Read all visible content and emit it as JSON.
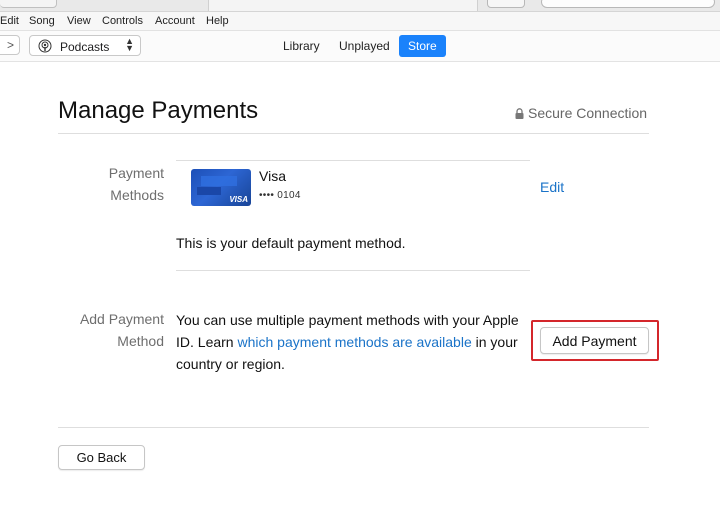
{
  "menu": [
    "Edit",
    "Song",
    "View",
    "Controls",
    "Account",
    "Help"
  ],
  "toolbar": {
    "forward_glyph": ">",
    "media_kind": "Podcasts",
    "media_icon": "podcast-icon",
    "tabs": [
      {
        "label": "Library",
        "active": false
      },
      {
        "label": "Unplayed",
        "active": false
      },
      {
        "label": "Store",
        "active": true
      }
    ]
  },
  "page": {
    "title": "Manage Payments",
    "secure_label": "Secure Connection",
    "secure_icon": "lock-icon"
  },
  "payment_methods": {
    "label_line1": "Payment",
    "label_line2": "Methods",
    "card_brand": "Visa",
    "card_logo_text": "VISA",
    "card_number": "•••• 0104",
    "edit_label": "Edit",
    "default_message": "This is your default payment method."
  },
  "add_payment": {
    "label_line1": "Add Payment",
    "label_line2": "Method",
    "desc_before": "You can use multiple payment methods with your Apple ID. Learn ",
    "desc_link": "which payment methods are available",
    "desc_after": " in your country or region.",
    "button_label": "Add Payment"
  },
  "footer": {
    "back_label": "Go Back"
  },
  "colors": {
    "accent": "#1a82fb",
    "link": "#1a73c8",
    "highlight_border": "#d4262b"
  }
}
